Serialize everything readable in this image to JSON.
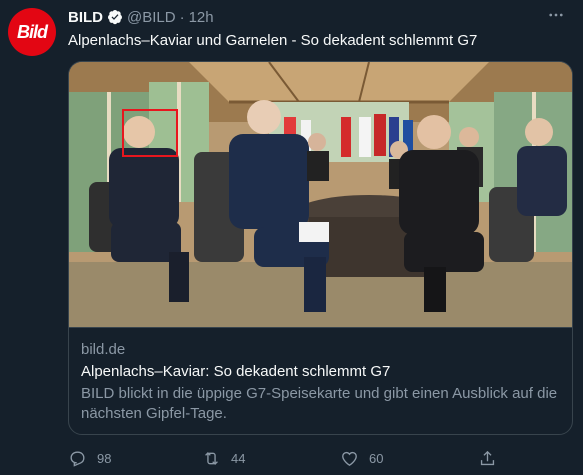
{
  "author": {
    "avatar_text": "Bild",
    "name": "BILD",
    "handle": "@BILD",
    "separator": "·",
    "time": "12h"
  },
  "tweet": {
    "text": "Alpenlachs–Kaviar und Garnelen - So dekadent schlemmt G7"
  },
  "card": {
    "domain": "bild.de",
    "title": "Alpenlachs–Kaviar: So dekadent schlemmt G7",
    "description": "BILD blickt in die üppige G7-Speisekarte und gibt einen Ausblick auf die nächsten Gipfel-Tage."
  },
  "actions": {
    "replies": "98",
    "retweets": "44",
    "likes": "60"
  },
  "icons": {
    "verified": "verified-badge-icon",
    "more": "more-horizontal-icon",
    "reply": "reply-icon",
    "retweet": "retweet-icon",
    "like": "heart-icon",
    "share": "share-icon"
  },
  "colors": {
    "background": "#15202b",
    "brand_red": "#e30613",
    "verified_blue": "#1d9bf0",
    "annotation_box": "#e8161e"
  }
}
